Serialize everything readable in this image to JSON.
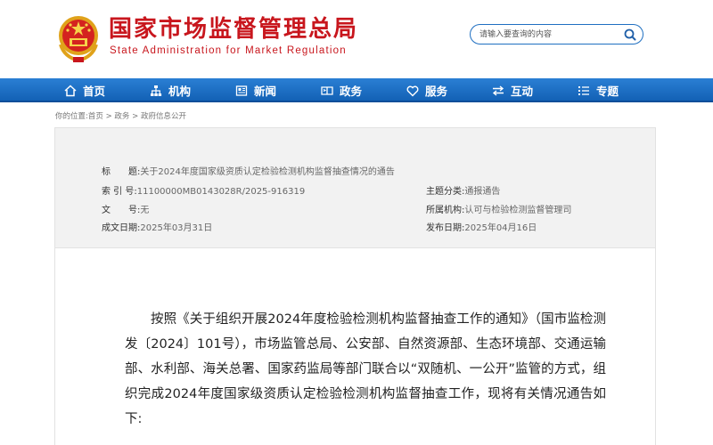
{
  "header": {
    "title": "国家市场监督管理总局",
    "subtitle": "State Administration for Market Regulation"
  },
  "search": {
    "placeholder": "请输入要查询的内容"
  },
  "nav": {
    "items": [
      {
        "label": "首页",
        "icon": "home-icon"
      },
      {
        "label": "机构",
        "icon": "org-chart-icon"
      },
      {
        "label": "新闻",
        "icon": "news-icon"
      },
      {
        "label": "政务",
        "icon": "government-icon"
      },
      {
        "label": "服务",
        "icon": "heart-icon"
      },
      {
        "label": "互动",
        "icon": "swap-arrows-icon"
      },
      {
        "label": "专题",
        "icon": "list-icon"
      }
    ]
  },
  "breadcrumb": {
    "prefix": "你的位置:",
    "items": [
      "首页",
      "政务",
      "政府信息公开"
    ],
    "separator": ">"
  },
  "meta": {
    "title_label": "标　　题:",
    "title_value": "关于2024年度国家级资质认定检验检测机构监督抽查情况的通告",
    "index_label": "索 引 号:",
    "index_value": "11100000MB0143028R/2025-916319",
    "doc_label": "文　　号:",
    "doc_value": "无",
    "date_label": "成文日期:",
    "date_value": "2025年03月31日",
    "category_label": "主题分类:",
    "category_value": "通报通告",
    "agency_label": "所属机构:",
    "agency_value": "认可与检验检测监督管理司",
    "publish_label": "发布日期:",
    "publish_value": "2025年04月16日"
  },
  "article": {
    "paragraph": "按照《关于组织开展2024年度检验检测机构监督抽查工作的通知》（国市监检测发〔2024〕101号），市场监管总局、公安部、自然资源部、生态环境部、交通运输部、水利部、海关总署、国家药监局等部门联合以“双随机、一公开”监管的方式，组织完成2024年度国家级资质认定检验检测机构监督抽查工作，现将有关情况通告如下:"
  },
  "colors": {
    "brand_red": "#c8161d",
    "nav_blue": "#1d6fc4"
  }
}
